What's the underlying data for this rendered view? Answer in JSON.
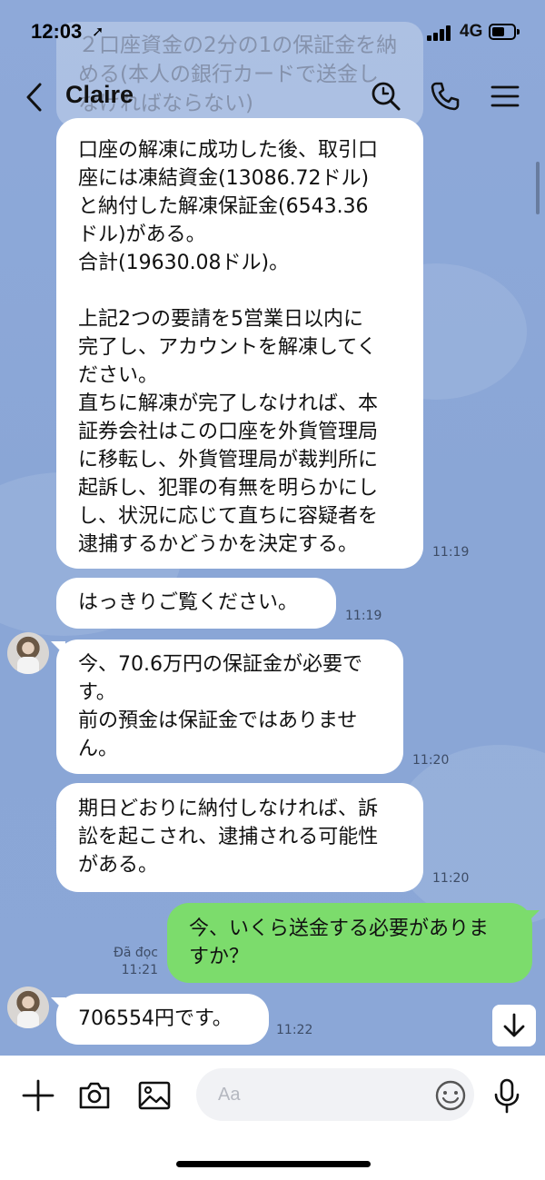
{
  "status_bar": {
    "time": "12:03",
    "location_glyph": "➚",
    "network": "4G"
  },
  "ghost_message": {
    "text": "２口座資金の2分の1の保証金を納\nめる(本人の銀行カードで送金し\nなければならない)"
  },
  "header": {
    "title": "Claire",
    "icons": [
      "back-icon",
      "search-icon",
      "phone-icon",
      "menu-icon"
    ]
  },
  "messages": [
    {
      "side": "incoming",
      "text": "口座の解凍に成功した後、取引口\n座には凍結資金(13086.72ドル)\nと納付した解凍保証金(6543.36\nドル)がある。\n合計(19630.08ドル)。\n\n上記2つの要請を5営業日以内に\n完了し、アカウントを解凍してく\nださい。\n直ちに解凍が完了しなければ、本\n証券会社はこの口座を外貨管理局\nに移転し、外貨管理局が裁判所に\n起訴し、犯罪の有無を明らかにし\nし、状況に応じて直ちに容疑者を\n逮捕するかどうかを決定する。",
      "time": "11:19"
    },
    {
      "side": "incoming",
      "text": "はっきりご覧ください。",
      "time": "11:19"
    },
    {
      "side": "incoming",
      "text": "今、70.6万円の保証金が必要で\nす。\n前の預金は保証金ではありませ\nん。",
      "time": "11:20"
    },
    {
      "side": "incoming",
      "text": "期日どおりに納付しなければ、訴\n訟を起こされ、逮捕される可能性\nがある。",
      "time": "11:20"
    },
    {
      "side": "outgoing",
      "text": "今、いくら送金する必要がありま\nすか？",
      "read_label": "Đã đọc",
      "time": "11:21"
    },
    {
      "side": "incoming",
      "text": "706554円です。",
      "time": "11:22"
    }
  ],
  "input_bar": {
    "placeholder": "Aa",
    "icons": [
      "plus-icon",
      "camera-icon",
      "image-icon",
      "emoji-icon",
      "microphone-icon"
    ]
  },
  "colors": {
    "chat_background": "#8aa8d8",
    "incoming_bubble": "#ffffff",
    "outgoing_bubble": "#7cdc6c"
  }
}
